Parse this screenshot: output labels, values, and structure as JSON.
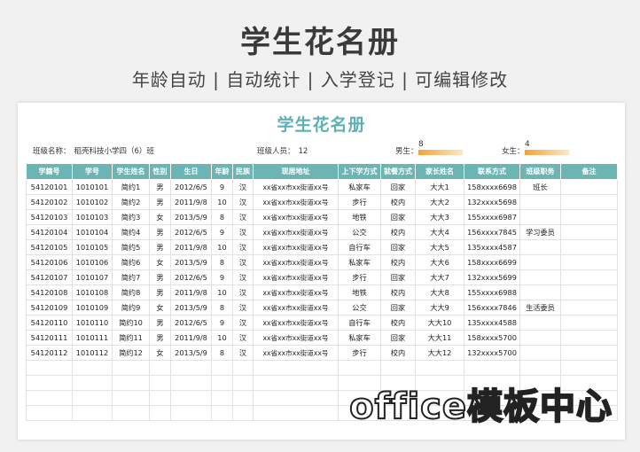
{
  "banner": {
    "title": "学生花名册",
    "subtitle": "年龄自动 | 自动统计 | 入学登记 | 可编辑修改"
  },
  "sheet": {
    "title": "学生花名册",
    "class_label": "班级名称：",
    "class_value": "稻壳科技小学四（6）班",
    "headcount_label": "班级人员：",
    "headcount_value": "12",
    "male_label": "男生：",
    "male_count": "8",
    "female_label": "女生：",
    "female_count": "4",
    "accent_color": "#6bb6b4"
  },
  "table": {
    "headers": [
      "学籍号",
      "学号",
      "学生姓名",
      "性别",
      "生日",
      "年龄",
      "民族",
      "现居地址",
      "上下学方式",
      "就餐方式",
      "家长姓名",
      "联系方式",
      "班级职务",
      "备注"
    ],
    "rows": [
      [
        "54120101",
        "1010101",
        "简约1",
        "男",
        "2012/6/5",
        "9",
        "汉",
        "xx省xx市xx街道xx号",
        "私家车",
        "回家",
        "大大1",
        "158xxxx6698",
        "班长",
        ""
      ],
      [
        "54120102",
        "1010102",
        "简约2",
        "男",
        "2011/9/8",
        "10",
        "汉",
        "xx省xx市xx街道xx号",
        "步行",
        "校内",
        "大大2",
        "132xxxx5698",
        "",
        ""
      ],
      [
        "54120103",
        "1010103",
        "简约3",
        "女",
        "2013/5/9",
        "8",
        "汉",
        "xx省xx市xx街道xx号",
        "地铁",
        "回家",
        "大大3",
        "155xxxx6987",
        "",
        ""
      ],
      [
        "54120104",
        "1010104",
        "简约4",
        "男",
        "2012/6/5",
        "9",
        "汉",
        "xx省xx市xx街道xx号",
        "公交",
        "校内",
        "大大4",
        "156xxxx7845",
        "学习委员",
        ""
      ],
      [
        "54120105",
        "1010105",
        "简约5",
        "男",
        "2011/9/8",
        "10",
        "汉",
        "xx省xx市xx街道xx号",
        "自行车",
        "回家",
        "大大5",
        "135xxxx4587",
        "",
        ""
      ],
      [
        "54120106",
        "1010106",
        "简约6",
        "女",
        "2013/5/9",
        "8",
        "汉",
        "xx省xx市xx街道xx号",
        "私家车",
        "校内",
        "大大6",
        "158xxxx6699",
        "",
        ""
      ],
      [
        "54120107",
        "1010107",
        "简约7",
        "男",
        "2012/6/5",
        "9",
        "汉",
        "xx省xx市xx街道xx号",
        "步行",
        "回家",
        "大大7",
        "132xxxx5699",
        "",
        ""
      ],
      [
        "54120108",
        "1010108",
        "简约8",
        "男",
        "2011/9/8",
        "10",
        "汉",
        "xx省xx市xx街道xx号",
        "地铁",
        "校内",
        "大大8",
        "155xxxx6988",
        "",
        ""
      ],
      [
        "54120109",
        "1010109",
        "简约9",
        "女",
        "2013/5/9",
        "8",
        "汉",
        "xx省xx市xx街道xx号",
        "公交",
        "回家",
        "大大9",
        "156xxxx7846",
        "生活委员",
        ""
      ],
      [
        "54120110",
        "1010110",
        "简约10",
        "男",
        "2012/6/5",
        "9",
        "汉",
        "xx省xx市xx街道xx号",
        "自行车",
        "校内",
        "大大10",
        "135xxxx4588",
        "",
        ""
      ],
      [
        "54120111",
        "1010111",
        "简约11",
        "男",
        "2011/9/8",
        "10",
        "汉",
        "xx省xx市xx街道xx号",
        "私家车",
        "回家",
        "大大11",
        "158xxxx5700",
        "",
        ""
      ],
      [
        "54120112",
        "1010112",
        "简约12",
        "女",
        "2013/5/9",
        "8",
        "汉",
        "xx省xx市xx街道xx号",
        "步行",
        "校内",
        "大大12",
        "132xxxx5700",
        "",
        ""
      ]
    ],
    "empty_rows": 4
  },
  "watermark": "office模板中心"
}
